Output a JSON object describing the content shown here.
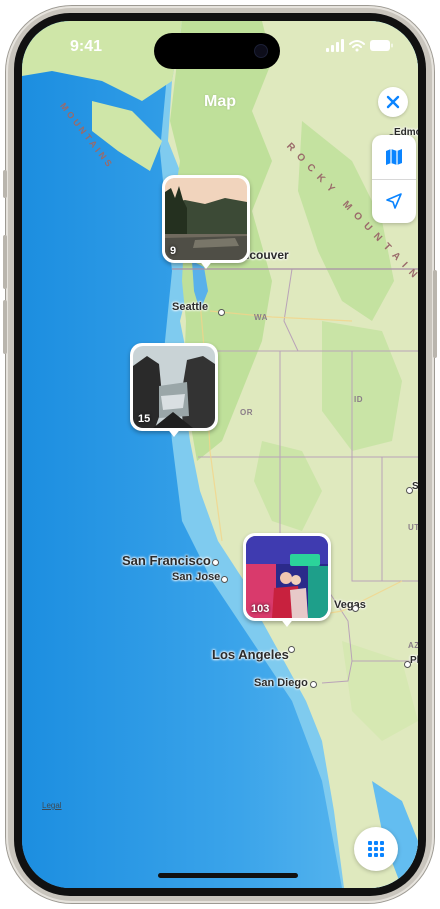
{
  "status_bar": {
    "time": "9:41"
  },
  "header": {
    "title": "Map"
  },
  "controls": {
    "close_icon": "xmark-icon",
    "map_mode_icon": "map-icon",
    "locate_icon": "location-arrow-icon",
    "grid_icon": "grid-icon"
  },
  "map": {
    "cities": [
      {
        "id": "edmonton",
        "label": "Edmonton"
      },
      {
        "id": "vancouver",
        "label": "Vancouver"
      },
      {
        "id": "seattle",
        "label": "Seattle"
      },
      {
        "id": "san-francisco",
        "label": "San Francisco"
      },
      {
        "id": "san-jose",
        "label": "San Jose"
      },
      {
        "id": "las-vegas",
        "label": "Las Vegas"
      },
      {
        "id": "los-angeles",
        "label": "Los Angeles"
      },
      {
        "id": "san-diego",
        "label": "San Diego"
      },
      {
        "id": "salt-lake",
        "label": "Sa"
      },
      {
        "id": "phoenix",
        "label": "Ph"
      }
    ],
    "states": [
      "WA",
      "OR",
      "ID",
      "UT",
      "AZ"
    ],
    "ranges": [
      "MOUNTAINS",
      "ROCKY MOUNTAINS"
    ],
    "legal_link": "Legal"
  },
  "photo_pins": [
    {
      "id": "vancouver",
      "count": "9"
    },
    {
      "id": "oregon-coast",
      "count": "15"
    },
    {
      "id": "los-angeles",
      "count": "103"
    }
  ],
  "colors": {
    "ocean": "#4da7e6",
    "land": "#dfe9be",
    "forest": "#bfe09a",
    "accent": "#0a84ff"
  }
}
